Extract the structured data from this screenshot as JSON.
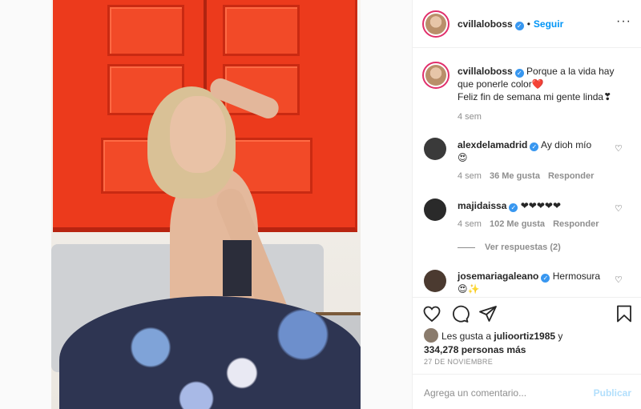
{
  "header": {
    "username": "cvillaloboss",
    "separator": "•",
    "follow_label": "Seguir",
    "more_label": "···"
  },
  "caption": {
    "username": "cvillaloboss",
    "text_line1": "Porque a la vida hay",
    "text_line2": "que ponerle color❤️",
    "text_line3": "Feliz fin de semana mi gente linda❣",
    "time": "4 sem"
  },
  "comments": [
    {
      "username": "alexdelamadrid",
      "text": "Ay dioh mío",
      "emoji": "😍",
      "time": "4 sem",
      "likes": "36 Me gusta",
      "reply_label": "Responder"
    },
    {
      "username": "majidaissa",
      "text": "❤❤❤❤❤",
      "time": "4 sem",
      "likes": "102 Me gusta",
      "reply_label": "Responder",
      "view_replies": "Ver respuestas (2)"
    },
    {
      "username": "josemariagaleano",
      "text": "Hermosura",
      "emoji": "😍✨"
    }
  ],
  "likes": {
    "prefix": "Les gusta a",
    "user": "julioortiz1985",
    "conj": "y",
    "others": "334,278 personas más"
  },
  "date": "27 DE NOVIEMBRE",
  "composer": {
    "placeholder": "Agrega un comentario...",
    "post_label": "Publicar"
  },
  "icons": [
    "heart-icon",
    "comment-icon",
    "share-icon",
    "bookmark-icon",
    "verified-icon",
    "more-icon"
  ],
  "colors": {
    "accent": "#0095f6",
    "verified": "#3897f0",
    "muted": "#8e8e8e"
  }
}
